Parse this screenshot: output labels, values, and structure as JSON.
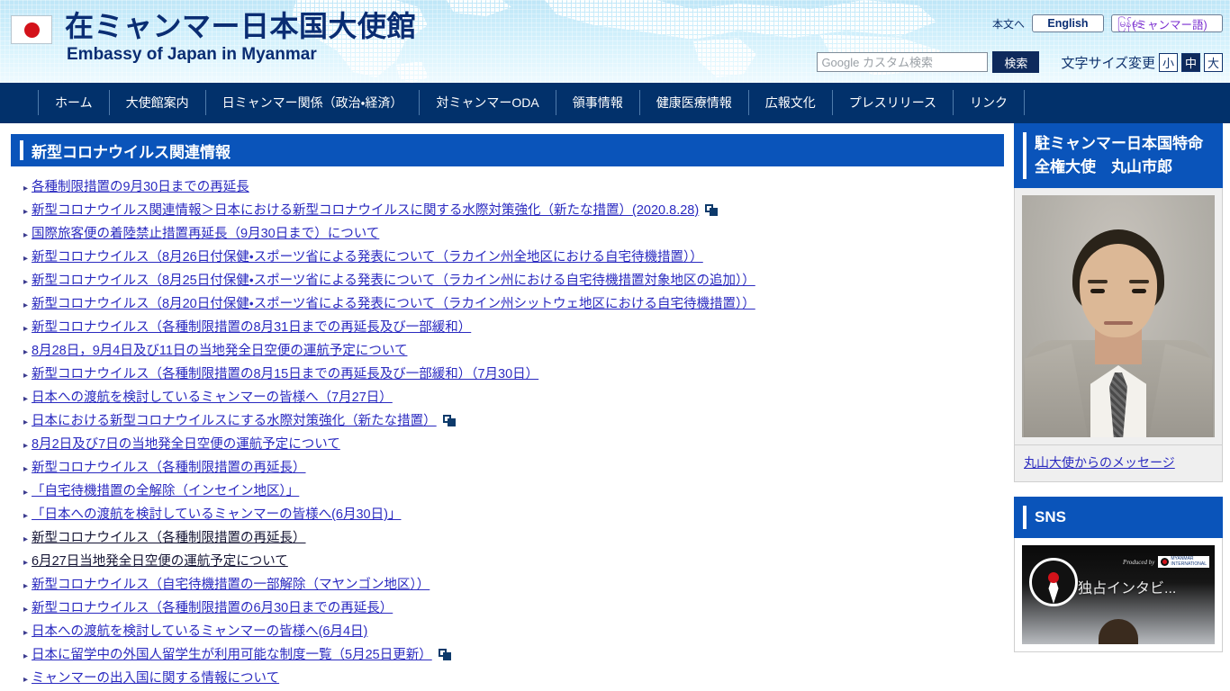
{
  "header": {
    "flag_icon": "japan-flag-icon",
    "title_ja": "在ミャンマー日本国大使館",
    "title_en": "Embassy of Japan in Myanmar",
    "skip_link": "本文へ",
    "lang_english": "English",
    "lang_myanmar_burmese": "မြန်မာ",
    "lang_myanmar_ja": "(ミャンマー語)",
    "search_placeholder": "Google カスタム検索",
    "search_value": "",
    "search_button": "検索",
    "fontsize_label": "文字サイズ変更",
    "fontsize_options": [
      "小",
      "中",
      "大"
    ],
    "fontsize_selected": "中"
  },
  "gnav": {
    "items": [
      {
        "label": "ホーム"
      },
      {
        "label": "大使館案内"
      },
      {
        "label": "日ミャンマー関係（政治・経済）"
      },
      {
        "label": "対ミャンマーODA"
      },
      {
        "label": "領事情報"
      },
      {
        "label": "健康医療情報"
      },
      {
        "label": "広報文化"
      },
      {
        "label": "プレスリリース"
      },
      {
        "label": "リンク"
      }
    ]
  },
  "main": {
    "heading": "新型コロナウイルス関連情報",
    "links": [
      {
        "label": "各種制限措置の9月30日までの再延長",
        "external": false,
        "visited": false
      },
      {
        "label": "新型コロナウイルス関連情報＞日本における新型コロナウイルスに関する水際対策強化（新たな措置）(2020.8.28)",
        "external": true,
        "visited": false
      },
      {
        "label": "国際旅客便の着陸禁止措置再延長（9月30日まで）について",
        "external": false,
        "visited": false
      },
      {
        "label": "新型コロナウイルス（8月26日付保健・スポーツ省による発表について（ラカイン州全地区における自宅待機措置））",
        "external": false,
        "visited": false
      },
      {
        "label": "新型コロナウイルス（8月25日付保健・スポーツ省による発表について（ラカイン州における自宅待機措置対象地区の追加））",
        "external": false,
        "visited": false
      },
      {
        "label": "新型コロナウイルス（8月20日付保健・スポーツ省による発表について（ラカイン州シットウェ地区における自宅待機措置））",
        "external": false,
        "visited": false
      },
      {
        "label": "新型コロナウイルス（各種制限措置の8月31日までの再延長及び一部緩和）",
        "external": false,
        "visited": false
      },
      {
        "label": "8月28日，9月4日及び11日の当地発全日空便の運航予定について",
        "external": false,
        "visited": false
      },
      {
        "label": "新型コロナウイルス（各種制限措置の8月15日までの再延長及び一部緩和）（7月30日）",
        "external": false,
        "visited": false
      },
      {
        "label": "日本への渡航を検討しているミャンマーの皆様へ（7月27日）",
        "external": false,
        "visited": false
      },
      {
        "label": "日本における新型コロナウイルスにする水際対策強化（新たな措置）",
        "external": true,
        "visited": false
      },
      {
        "label": "8月2日及び7日の当地発全日空便の運航予定について",
        "external": false,
        "visited": false
      },
      {
        "label": "新型コロナウイルス（各種制限措置の再延長）",
        "external": false,
        "visited": false
      },
      {
        "label": "「自宅待機措置の全解除（インセイン地区）」",
        "external": false,
        "visited": false
      },
      {
        "label": "「日本への渡航を検討しているミャンマーの皆様へ(6月30日)」",
        "external": false,
        "visited": false
      },
      {
        "label": "新型コロナウイルス（各種制限措置の再延長）",
        "external": false,
        "visited": true
      },
      {
        "label": "6月27日当地発全日空便の運航予定について",
        "external": false,
        "visited": true
      },
      {
        "label": "新型コロナウイルス（自宅待機措置の一部解除（マヤンゴン地区））",
        "external": false,
        "visited": false
      },
      {
        "label": "新型コロナウイルス（各種制限措置の6月30日までの再延長）",
        "external": false,
        "visited": false
      },
      {
        "label": "日本への渡航を検討しているミャンマーの皆様へ(6月4日)",
        "external": false,
        "visited": false
      },
      {
        "label": "日本に留学中の外国人留学生が利用可能な制度一覧（5月25日更新）",
        "external": true,
        "visited": false
      },
      {
        "label": "ミャンマーの出入国に関する情報について",
        "external": false,
        "visited": false
      }
    ]
  },
  "sidebar": {
    "ambassador": {
      "heading": "駐ミャンマー日本国特命全権大使　丸山市郎",
      "photo_alt": "ambassador-portrait",
      "message_link": "丸山大使からのメッセージ"
    },
    "sns": {
      "heading": "SNS",
      "video_caption": "独占インタビ...",
      "video_produced_by": "Produced by"
    }
  },
  "colors": {
    "nav_bg": "#02316b",
    "heading_bg": "#0a54ba",
    "link": "#2a2ac0",
    "visited_link": "#161636",
    "title": "#0a2d73"
  }
}
